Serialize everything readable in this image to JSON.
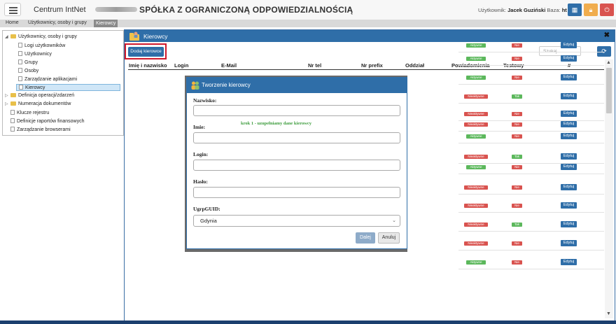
{
  "topbar": {
    "app_name": "Centrum IntNet",
    "company": "SPÓŁKA Z OGRANICZONĄ ODPOWIEDZIALNOŚCIĄ",
    "user_label": "Użytkownik:",
    "user_name": "Jacek Guziński",
    "base_label": "Baza:",
    "base_value": "ht",
    "buttons": [
      {
        "icon": "grid-icon",
        "color": "#2f6ea8"
      },
      {
        "icon": "lock-icon",
        "color": "#f0ad4e"
      },
      {
        "icon": "logout-icon",
        "color": "#d9534f"
      }
    ]
  },
  "breadcrumb": [
    "Home",
    "Użytkownicy, osoby i grupy",
    "Kierowcy"
  ],
  "tree": {
    "root": "Użytkownicy, osoby i grupy",
    "children": [
      "Logi użytkowników",
      "Użytkownicy",
      "Grupy",
      "Osoby",
      "Zarządzanie aplikacjami",
      "Kierowcy"
    ],
    "others": [
      {
        "label": "Definicja operacji/zdarzeń",
        "type": "folder"
      },
      {
        "label": "Numeracja dokumentów",
        "type": "folder"
      },
      {
        "label": "Klucze rejestru",
        "type": "doc"
      },
      {
        "label": "Definicje raportów finansowych",
        "type": "doc"
      },
      {
        "label": "Zarządzanie browserami",
        "type": "doc"
      }
    ]
  },
  "panel": {
    "title": "Kierowcy",
    "add_button": "Dodaj kierowce",
    "search_placeholder": "Szukaj...",
    "columns": [
      "Imię i nazwisko",
      "Login",
      "E-Mail",
      "Nr tel",
      "Nr prefix",
      "Oddział",
      "Powiadomienia",
      "Testowy",
      "#"
    ],
    "edit_label": "Edytuj",
    "rows": [
      {
        "notify": "Aktywne",
        "test": "Nie"
      },
      {
        "notify": "Aktywne",
        "test": "Nie"
      },
      {
        "notify": "Aktywne",
        "test": "Nie"
      },
      {
        "notify": "Nieaktywne",
        "test": "Tak"
      },
      {
        "notify": "Nieaktywne",
        "test": "Nie"
      },
      {
        "notify": "Nieaktywne",
        "test": "Nie"
      },
      {
        "notify": "Aktywne",
        "test": "Nie"
      },
      {
        "notify": "Nieaktywne",
        "test": "Tak"
      },
      {
        "notify": "Aktywne",
        "test": "Nie"
      },
      {
        "notify": "Nieaktywne",
        "test": "Nie"
      },
      {
        "notify": "Nieaktywne",
        "test": "Nie"
      },
      {
        "notify": "Nieaktywne",
        "test": "Tak"
      },
      {
        "notify": "Nieaktywne",
        "test": "Nie"
      },
      {
        "notify": "Aktywne",
        "test": "Nie"
      }
    ]
  },
  "dialog": {
    "title": "Tworzenie kierowcy",
    "fields": [
      {
        "label": "Nazwisko:",
        "value": ""
      },
      {
        "label": "Imie:",
        "value": ""
      },
      {
        "label": "Login:",
        "value": ""
      },
      {
        "label": "Hasło:",
        "value": ""
      }
    ],
    "hint": "krok 1 - uzupełniamy dane kierowcy",
    "select_label": "UgrpGUID:",
    "select_value": "Gdynia",
    "next_button": "Dalej",
    "cancel_button": "Anuluj"
  }
}
